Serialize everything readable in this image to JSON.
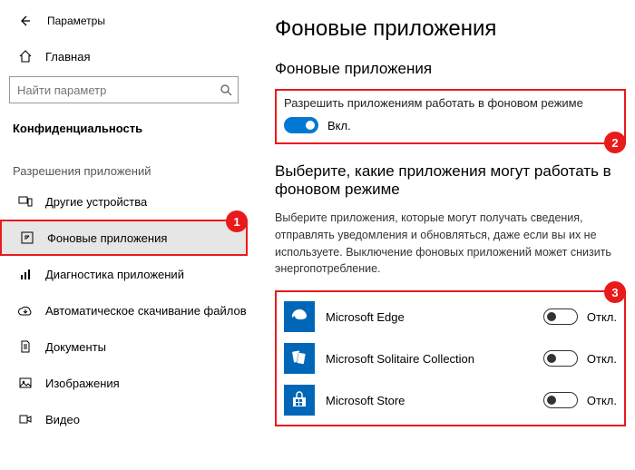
{
  "topbar": {
    "title": "Параметры"
  },
  "sidebar": {
    "home": "Главная",
    "search_placeholder": "Найти параметр",
    "section_main": "Конфиденциальность",
    "section_sub": "Разрешения приложений",
    "items": [
      {
        "label": "Другие устройства",
        "icon": "devices"
      },
      {
        "label": "Фоновые приложения",
        "icon": "background",
        "active": true
      },
      {
        "label": "Диагностика приложений",
        "icon": "diagnostics"
      },
      {
        "label": "Автоматическое скачивание файлов",
        "icon": "download"
      },
      {
        "label": "Документы",
        "icon": "document"
      },
      {
        "label": "Изображения",
        "icon": "image"
      },
      {
        "label": "Видео",
        "icon": "video"
      }
    ]
  },
  "main": {
    "h1": "Фоновые приложения",
    "h2a": "Фоновые приложения",
    "allow_label": "Разрешить приложениям работать в фоновом режиме",
    "allow_state": "Вкл.",
    "h2b": "Выберите, какие приложения могут работать в фоновом режиме",
    "explain": "Выберите приложения, которые могут получать сведения, отправлять уведомления и обновляться, даже если вы их не используете. Выключение фоновых приложений может снизить энергопотребление.",
    "off_label": "Откл.",
    "apps": [
      {
        "name": "Microsoft Edge"
      },
      {
        "name": "Microsoft Solitaire Collection"
      },
      {
        "name": "Microsoft Store"
      }
    ]
  },
  "annotations": {
    "b1": "1",
    "b2": "2",
    "b3": "3"
  }
}
